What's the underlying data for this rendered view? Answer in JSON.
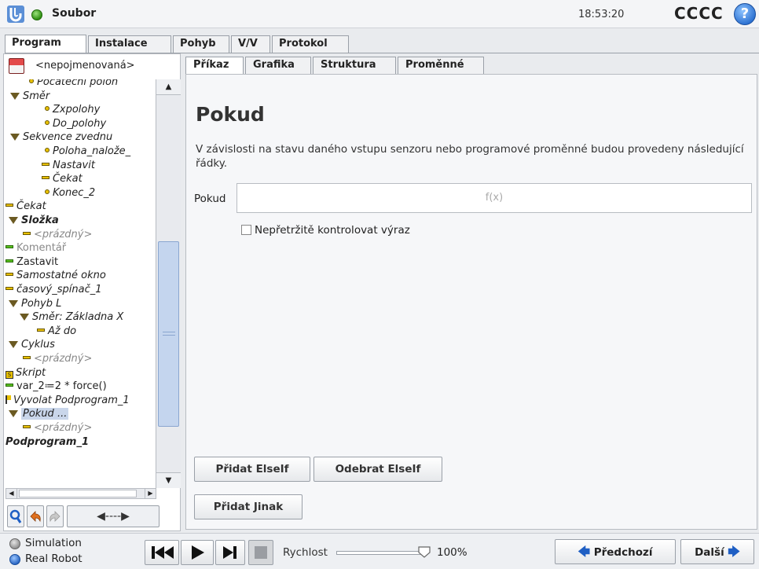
{
  "topbar": {
    "file_label": "Soubor",
    "clock": "18:53:20",
    "robot_name": "CCCC",
    "help_glyph": "?"
  },
  "main_tabs": [
    {
      "label": "Program",
      "active": true
    },
    {
      "label": "Instalace",
      "active": false
    },
    {
      "label": "Pohyb",
      "active": false
    },
    {
      "label": "V/V",
      "active": false
    },
    {
      "label": "Protokol",
      "active": false
    }
  ],
  "program": {
    "name": "<nepojmenovaná>"
  },
  "tree": [
    {
      "text": "Počáteční poloh",
      "icon": "dot-yellow",
      "style": "it"
    },
    {
      "text": "Směr",
      "icon": "triangle",
      "style": "it"
    },
    {
      "text": "Zxpolohy",
      "icon": "dot-yellow",
      "style": "it"
    },
    {
      "text": "Do_polohy",
      "icon": "dot-yellow",
      "style": "it"
    },
    {
      "text": "Sekvence zvednu",
      "icon": "triangle",
      "style": "it"
    },
    {
      "text": "Poloha_nalože_",
      "icon": "dot-yellow",
      "style": "it"
    },
    {
      "text": "Nastavit",
      "icon": "bar-yellow",
      "style": "it"
    },
    {
      "text": "Čekat",
      "icon": "bar-yellow",
      "style": "it"
    },
    {
      "text": "Konec_2",
      "icon": "dot-yellow",
      "style": "it"
    },
    {
      "text": "Čekat",
      "icon": "bar-yellow",
      "style": "it"
    },
    {
      "text": "Složka",
      "icon": "triangle",
      "style": "it bd"
    },
    {
      "text": "<prázdný>",
      "icon": "bar-yellow",
      "style": "it gray"
    },
    {
      "text": "Komentář",
      "icon": "bar-green",
      "style": "gray"
    },
    {
      "text": "Zastavit",
      "icon": "bar-green",
      "style": ""
    },
    {
      "text": "Samostatné okno",
      "icon": "bar-yellow",
      "style": "it"
    },
    {
      "text": "časový_spínač_1",
      "icon": "bar-yellow",
      "style": "it"
    },
    {
      "text": "Pohyb L",
      "icon": "triangle",
      "style": "it"
    },
    {
      "text": "Směr: Základna X",
      "icon": "triangle",
      "style": "it"
    },
    {
      "text": "Až do",
      "icon": "bar-yellow",
      "style": "it"
    },
    {
      "text": "Cyklus",
      "icon": "triangle",
      "style": "it"
    },
    {
      "text": "<prázdný>",
      "icon": "bar-yellow",
      "style": "it gray"
    },
    {
      "text": "Skript",
      "icon": "script",
      "style": "it"
    },
    {
      "text": "var_2≔2 * force()",
      "icon": "bar-green",
      "style": ""
    },
    {
      "text": "Vyvolat Podprogram_1",
      "icon": "flag",
      "style": "it"
    },
    {
      "text": "Pokud ...",
      "icon": "triangle",
      "style": "it",
      "selected": true
    },
    {
      "text": "<prázdný>",
      "icon": "bar-yellow",
      "style": "it gray"
    },
    {
      "text": "Podprogram_1",
      "icon": "none",
      "style": "it bd"
    }
  ],
  "sub_tabs": [
    {
      "label": "Příkaz",
      "active": true
    },
    {
      "label": "Grafika",
      "active": false
    },
    {
      "label": "Struktura",
      "active": false
    },
    {
      "label": "Proměnné",
      "active": false
    }
  ],
  "command": {
    "title": "Pokud",
    "description": "V závislosti na stavu daného vstupu senzoru nebo programové proměnné budou provedeny následující řádky.",
    "expr_label": "Pokud",
    "expr_placeholder": "f(x)",
    "check_label": "Nepřetržitě kontrolovat výraz",
    "check_checked": false,
    "add_elseif": "Přidat ElseIf",
    "remove_elseif": "Odebrat ElseIf",
    "add_else": "Přidat Jinak"
  },
  "footer": {
    "simulation_label": "Simulation",
    "real_robot_label": "Real Robot",
    "active_mode": "Real Robot",
    "speed_label": "Rychlost",
    "speed_value": "100%",
    "speed_fraction": 1.0,
    "prev_label": "Předchozí",
    "next_label": "Další"
  },
  "colors": {
    "accent_blue": "#1f5fc4",
    "node_yellow": "#e9c100",
    "node_green": "#58c020",
    "selection": "#c9d6ea"
  }
}
